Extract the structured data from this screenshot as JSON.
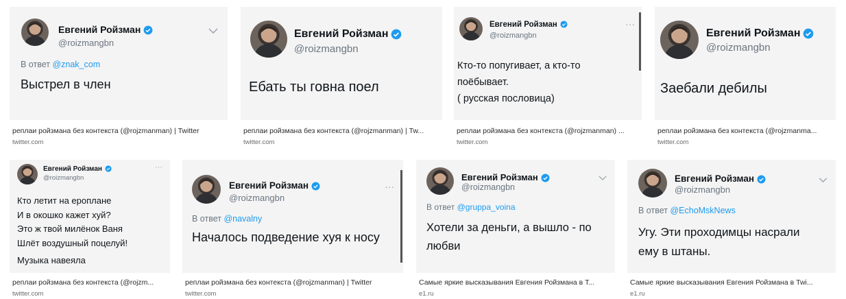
{
  "results": [
    {
      "name": "Евгений Ройзман",
      "handle": "@roizmangbn",
      "reply_prefix": "В ответ",
      "reply_to": "@znak_com",
      "text": "Выстрел в член",
      "caption": "реплаи ройзмана без контекста (@rojzmanman) | Twitter",
      "domain": "twitter.com",
      "header_icon": "chevron-down-icon"
    },
    {
      "name": "Евгений Ройзман",
      "handle": "@roizmangbn",
      "text": "Ебать ты говна поел",
      "caption": "реплаи ройзмана без контекста (@rojzmanman) | Tw...",
      "domain": "twitter.com"
    },
    {
      "name": "Евгений Ройзман",
      "handle": "@roizmangbn",
      "text": "Кто-то попугивает, а кто-то\nпоёбывает.\n( русская пословица)",
      "caption": "реплаи ройзмана без контекста (@rojzmanman) ...",
      "domain": "twitter.com",
      "header_icon": "more-icon"
    },
    {
      "name": "Евгений Ройзман",
      "handle": "@roizmangbn",
      "text": "Заебали дебилы",
      "caption": "реплаи ройзмана без контекста (@rojzmanma...",
      "domain": "twitter.com"
    },
    {
      "name": "Евгений Ройзман",
      "handle": "@roizmangbn",
      "text": "Кто летит на ероплане\nИ в окошко кажет хуй?\nЭто ж твой милёнок Ваня\nШлёт воздушный поцелуй!",
      "text_extra": "Музыка навеяла",
      "caption": "реплаи ройзмана без контекста (@rojzm...",
      "domain": "twitter.com",
      "header_icon": "more-icon"
    },
    {
      "name": "Евгений Ройзман",
      "handle": "@roizmangbn",
      "reply_prefix": "В ответ",
      "reply_to": "@navalny",
      "text": "Началось подведение хуя к носу",
      "caption": "реплаи ройзмана без контекста (@rojzmanman) | Twitter",
      "domain": "twitter.com",
      "header_icon": "more-icon"
    },
    {
      "name": "Евгений Ройзман",
      "handle": "@roizmangbn",
      "reply_prefix": "В ответ",
      "reply_to": "@gruppa_voina",
      "text": "Хотели за деньги, а вышло - по\nлюбви",
      "caption": "Самые яркие высказывания Евгения Ройзмана в Т...",
      "domain": "e1.ru",
      "header_icon": "chevron-down-icon"
    },
    {
      "name": "Евгений Ройзман",
      "handle": "@roizmangbn",
      "reply_prefix": "В ответ",
      "reply_to": "@EchoMskNews",
      "text": "Угу. Эти проходимцы насрали\nему в штаны.",
      "caption": "Самые яркие высказывания Евгения Ройзмана в Twi...",
      "domain": "e1.ru",
      "header_icon": "chevron-down-icon"
    }
  ],
  "colors": {
    "verified": "#1d9bf0",
    "mention": "#1d9bf0",
    "card_bg": "#f4f4f4"
  }
}
